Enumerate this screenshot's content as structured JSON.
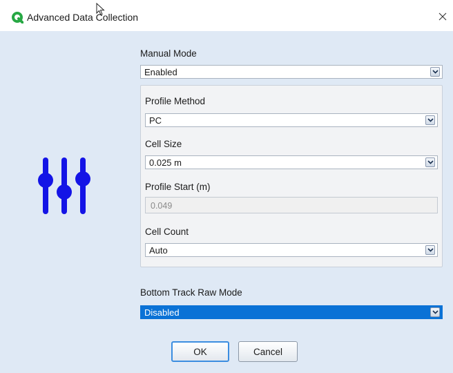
{
  "window": {
    "title": "Advanced Data Collection",
    "icons": {
      "app": "q-logo-icon",
      "close": "close-icon",
      "cursor": "mouse-pointer-icon"
    }
  },
  "sidebar": {
    "icon": "sliders-icon",
    "icon_color": "#1414e6"
  },
  "form": {
    "manual_mode": {
      "label": "Manual Mode",
      "value": "Enabled"
    },
    "profile_method": {
      "label": "Profile Method",
      "value": "PC"
    },
    "cell_size": {
      "label": "Cell Size",
      "value": "0.025 m"
    },
    "profile_start": {
      "label": "Profile Start (m)",
      "value": "0.049"
    },
    "cell_count": {
      "label": "Cell Count",
      "value": "Auto"
    },
    "bottom_track_raw_mode": {
      "label": "Bottom Track Raw Mode",
      "value": "Disabled"
    }
  },
  "buttons": {
    "ok": "OK",
    "cancel": "Cancel"
  },
  "colors": {
    "dialog_bg": "#dfe9f5",
    "group_bg": "#f2f3f5",
    "selection": "#0a72d6",
    "accent_logo": "#27a844"
  }
}
